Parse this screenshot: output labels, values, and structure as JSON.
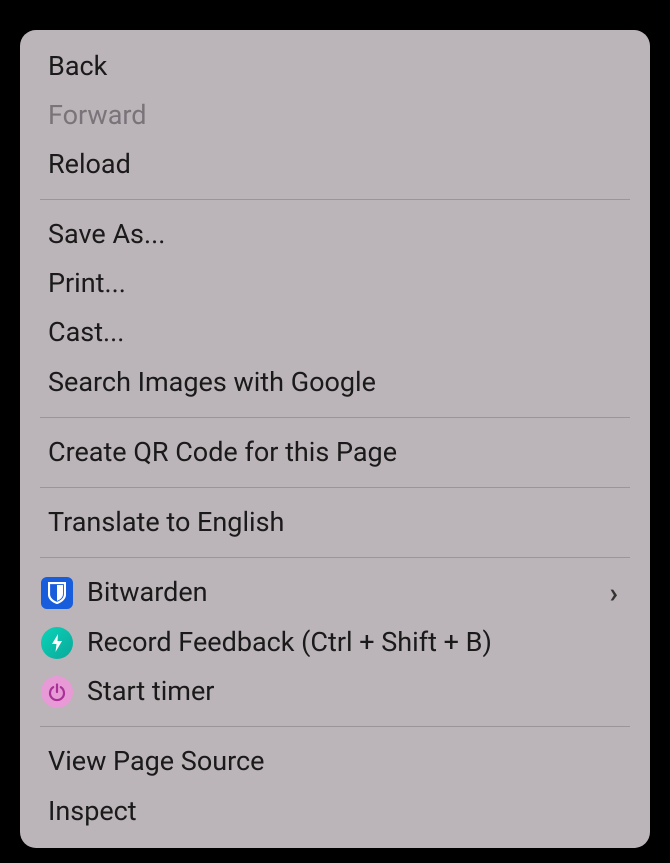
{
  "menu": {
    "groups": [
      [
        {
          "id": "back",
          "label": "Back",
          "disabled": false
        },
        {
          "id": "forward",
          "label": "Forward",
          "disabled": true
        },
        {
          "id": "reload",
          "label": "Reload",
          "disabled": false
        }
      ],
      [
        {
          "id": "save-as",
          "label": "Save As...",
          "disabled": false
        },
        {
          "id": "print",
          "label": "Print...",
          "disabled": false
        },
        {
          "id": "cast",
          "label": "Cast...",
          "disabled": false
        },
        {
          "id": "search-images",
          "label": "Search Images with Google",
          "disabled": false
        }
      ],
      [
        {
          "id": "create-qr",
          "label": "Create QR Code for this Page",
          "disabled": false
        }
      ],
      [
        {
          "id": "translate",
          "label": "Translate to English",
          "disabled": false
        }
      ],
      [
        {
          "id": "bitwarden",
          "label": "Bitwarden",
          "icon": "bitwarden",
          "submenu": true
        },
        {
          "id": "record-feedback",
          "label": "Record Feedback (Ctrl + Shift + B)",
          "icon": "feedback"
        },
        {
          "id": "start-timer",
          "label": "Start timer",
          "icon": "timer"
        }
      ],
      [
        {
          "id": "view-source",
          "label": "View Page Source",
          "disabled": false
        },
        {
          "id": "inspect",
          "label": "Inspect",
          "disabled": false
        }
      ]
    ]
  }
}
